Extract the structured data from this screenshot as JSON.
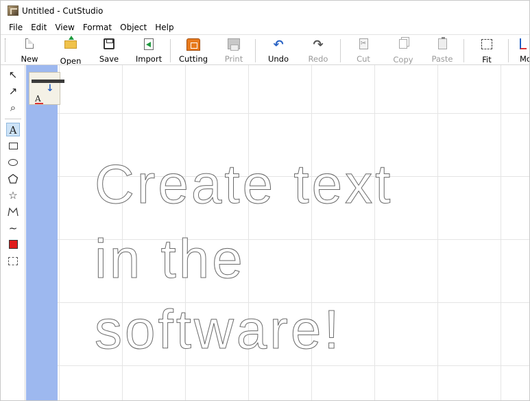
{
  "window": {
    "title": "Untitled - CutStudio"
  },
  "menu": [
    "File",
    "Edit",
    "View",
    "Format",
    "Object",
    "Help"
  ],
  "toolbar": {
    "new": "New",
    "open": "Open",
    "save": "Save",
    "import": "Import",
    "cutting": "Cutting",
    "print": "Print",
    "undo": "Undo",
    "redo": "Redo",
    "cut": "Cut",
    "copy": "Copy",
    "paste": "Paste",
    "fit": "Fit",
    "move": "Mo"
  },
  "float_panel": {
    "label": "A"
  },
  "tools": {
    "arrow": "↖",
    "node": "↗",
    "zoom": "⌕",
    "text": "A",
    "star": "☆",
    "polyline": "∧",
    "freehand": "∼"
  },
  "canvas": {
    "lines": [
      "Create text",
      "in the",
      "software!"
    ]
  },
  "colors": {
    "ruler": "#9db8ef",
    "accent": "#2a63c4",
    "fill_swatch": "#e01b1b"
  }
}
